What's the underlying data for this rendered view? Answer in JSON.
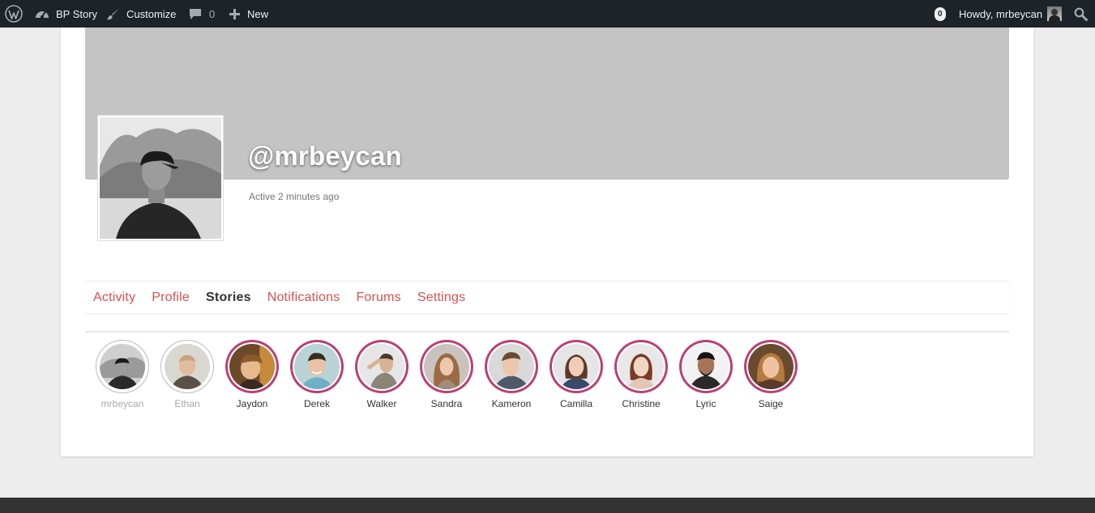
{
  "admin_bar": {
    "site_name": "BP Story",
    "customize_label": "Customize",
    "comments_count": "0",
    "new_label": "New",
    "notifications_count": "0",
    "greeting": "Howdy, mrbeycan",
    "icons": [
      "wordpress-icon",
      "dashboard-icon",
      "paintbrush-icon",
      "comment-icon",
      "plus-icon",
      "search-icon"
    ]
  },
  "profile": {
    "username": "@mrbeycan",
    "last_active": "Active 2 minutes ago"
  },
  "nav": {
    "items": [
      "Activity",
      "Profile",
      "Stories",
      "Notifications",
      "Forums",
      "Settings"
    ],
    "current": "Stories"
  },
  "stories": [
    {
      "name": "mrbeycan",
      "seen": true
    },
    {
      "name": "Ethan",
      "seen": true
    },
    {
      "name": "Jaydon",
      "seen": false
    },
    {
      "name": "Derek",
      "seen": false
    },
    {
      "name": "Walker",
      "seen": false
    },
    {
      "name": "Sandra",
      "seen": false
    },
    {
      "name": "Kameron",
      "seen": false
    },
    {
      "name": "Camilla",
      "seen": false
    },
    {
      "name": "Christine",
      "seen": false
    },
    {
      "name": "Lyric",
      "seen": false
    },
    {
      "name": "Saige",
      "seen": false
    }
  ],
  "colors": {
    "admin_bar_bg": "#1d2327",
    "nav_link": "#d5524f",
    "story_ring_unseen": "#b94177",
    "cover": "#c4c4c4",
    "footer": "#333333"
  }
}
